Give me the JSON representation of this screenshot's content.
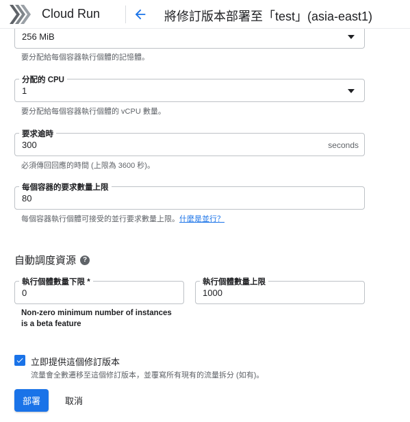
{
  "header": {
    "app_name": "Cloud Run",
    "page_title": "將修訂版本部署至「test」(asia-east1)"
  },
  "memory": {
    "value": "256 MiB",
    "hint": "要分配給每個容器執行個體的記憶體。"
  },
  "cpu": {
    "label": "分配的 CPU",
    "value": "1",
    "hint": "要分配給每個容器執行個體的 vCPU 數量。"
  },
  "timeout": {
    "label": "要求逾時",
    "value": "300",
    "suffix": "seconds",
    "hint": "必須傳回回應的時間 (上限為 3600 秒)。"
  },
  "concurrency": {
    "label": "每個容器的要求數量上限",
    "value": "80",
    "hint": "每個容器執行個體可接受的並行要求數量上限。",
    "link": "什麼是並行？"
  },
  "autoscaling": {
    "title": "自動調度資源",
    "help_icon": "?",
    "min_label": "執行個體數量下限 *",
    "min_value": "0",
    "max_label": "執行個體數量上限",
    "max_value": "1000",
    "beta_note": "Non-zero minimum number of instances is a beta feature"
  },
  "serve": {
    "label": "立即提供這個修訂版本",
    "checked": true,
    "hint": "流量會全數遷移至這個修訂版本，並覆寫所有現有的流量拆分 (如有)。"
  },
  "actions": {
    "deploy": "部署",
    "cancel": "取消"
  },
  "colors": {
    "accent": "#1a73e8",
    "text": "#202124",
    "hint": "#5f6368",
    "border": "#bdc1c6"
  },
  "icons": {
    "logo": "cloud-run-logo",
    "back": "arrow-back-icon",
    "dropdown": "dropdown-caret-icon",
    "help": "help-icon",
    "check": "check-icon"
  }
}
